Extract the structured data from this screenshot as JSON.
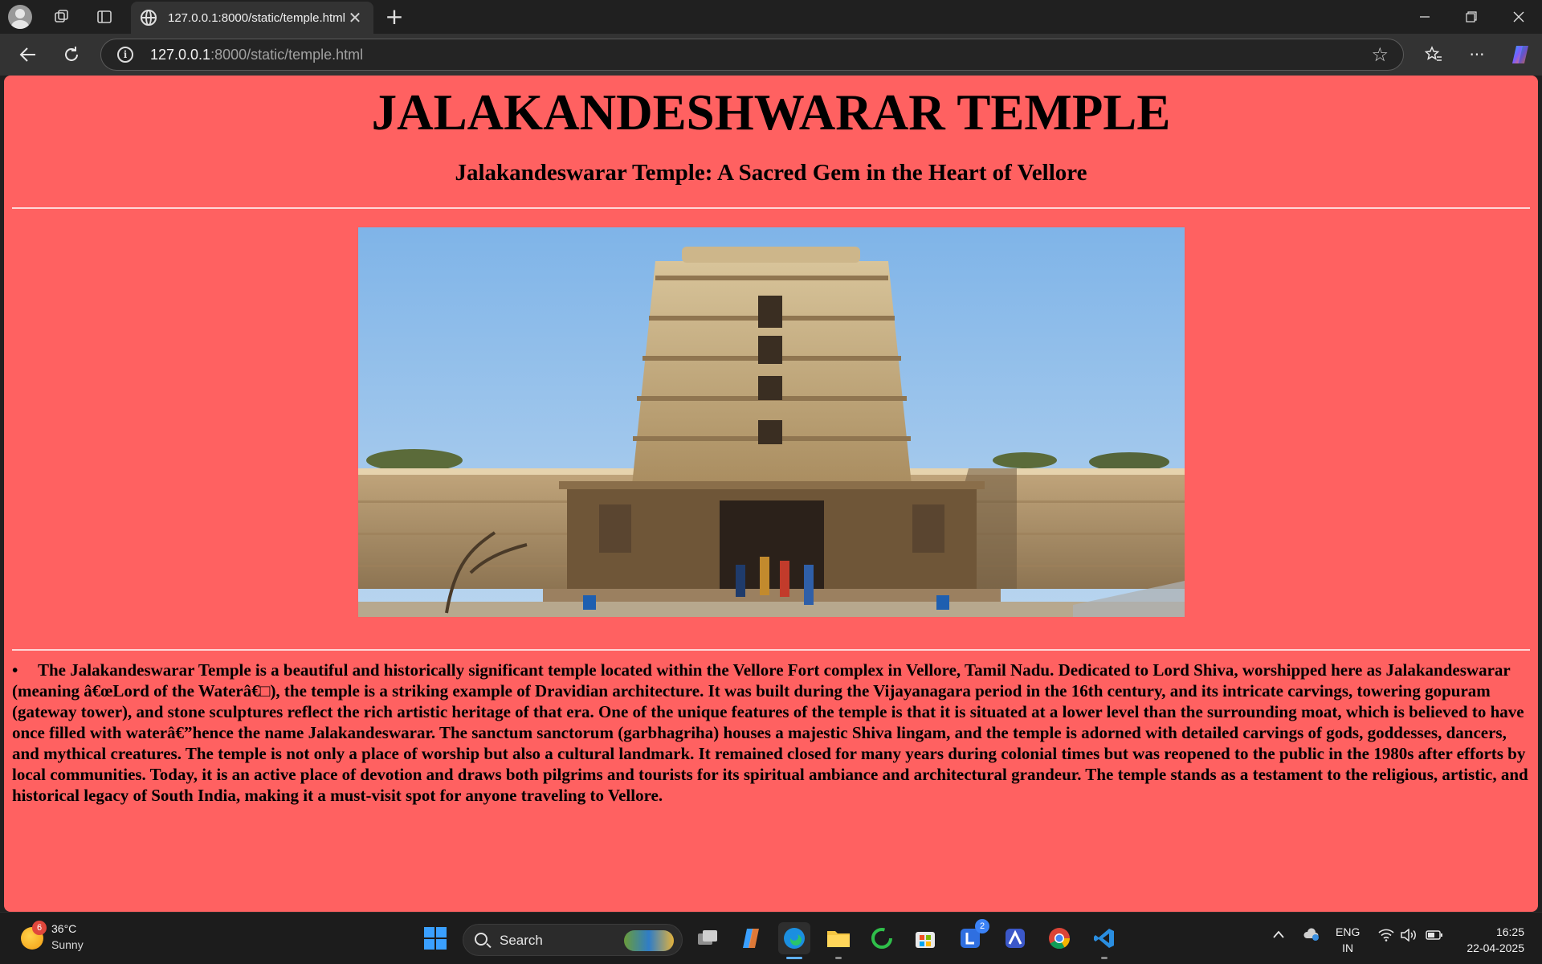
{
  "browser": {
    "tab_title": "127.0.0.1:8000/static/temple.html",
    "url_host": "127.0.0.1",
    "url_rest": ":8000/static/temple.html"
  },
  "page": {
    "title": "JALAKANDESHWARAR TEMPLE",
    "subtitle": "Jalakandeswarar Temple: A Sacred Gem in the Heart of Vellore",
    "bullet": "•",
    "paragraph": "The Jalakandeswarar Temple is a beautiful and historically significant temple located within the Vellore Fort complex in Vellore, Tamil Nadu. Dedicated to Lord Shiva, worshipped here as Jalakandeswarar (meaning â€œLord of the Waterâ€□), the temple is a striking example of Dravidian architecture. It was built during the Vijayanagara period in the 16th century, and its intricate carvings, towering gopuram (gateway tower), and stone sculptures reflect the rich artistic heritage of that era. One of the unique features of the temple is that it is situated at a lower level than the surrounding moat, which is believed to have once filled with waterâ€”hence the name Jalakandeswarar. The sanctum sanctorum (garbhagriha) houses a majestic Shiva lingam, and the temple is adorned with detailed carvings of gods, goddesses, dancers, and mythical creatures. The temple is not only a place of worship but also a cultural landmark. It remained closed for many years during colonial times but was reopened to the public in the 1980s after efforts by local communities. Today, it is an active place of devotion and draws both pilgrims and tourists for its spiritual ambiance and architectural grandeur. The temple stands as a testament to the religious, artistic, and historical legacy of South India, making it a must-visit spot for anyone traveling to Vellore.",
    "background_color": "#ff6161"
  },
  "taskbar": {
    "weather_badge": "6",
    "weather_temp": "36°C",
    "weather_condition": "Sunny",
    "search_label": "Search",
    "notification_badge": "2",
    "lang_line1": "ENG",
    "lang_line2": "IN",
    "time": "16:25",
    "date": "22-04-2025"
  },
  "icons": [
    "profile-icon",
    "workspaces-icon",
    "tab-actions-icon",
    "globe-icon",
    "close-icon",
    "new-tab-icon",
    "minimize-icon",
    "restore-icon",
    "window-close-icon",
    "back-icon",
    "refresh-icon",
    "site-info-icon",
    "favorite-star-icon",
    "favorites-icon",
    "more-icon",
    "copilot-icon",
    "windows-start-icon",
    "task-view-icon",
    "edge-icon",
    "file-explorer-icon",
    "store-icon",
    "chrome-icon",
    "vscode-icon",
    "wifi-icon",
    "volume-icon",
    "battery-icon"
  ]
}
